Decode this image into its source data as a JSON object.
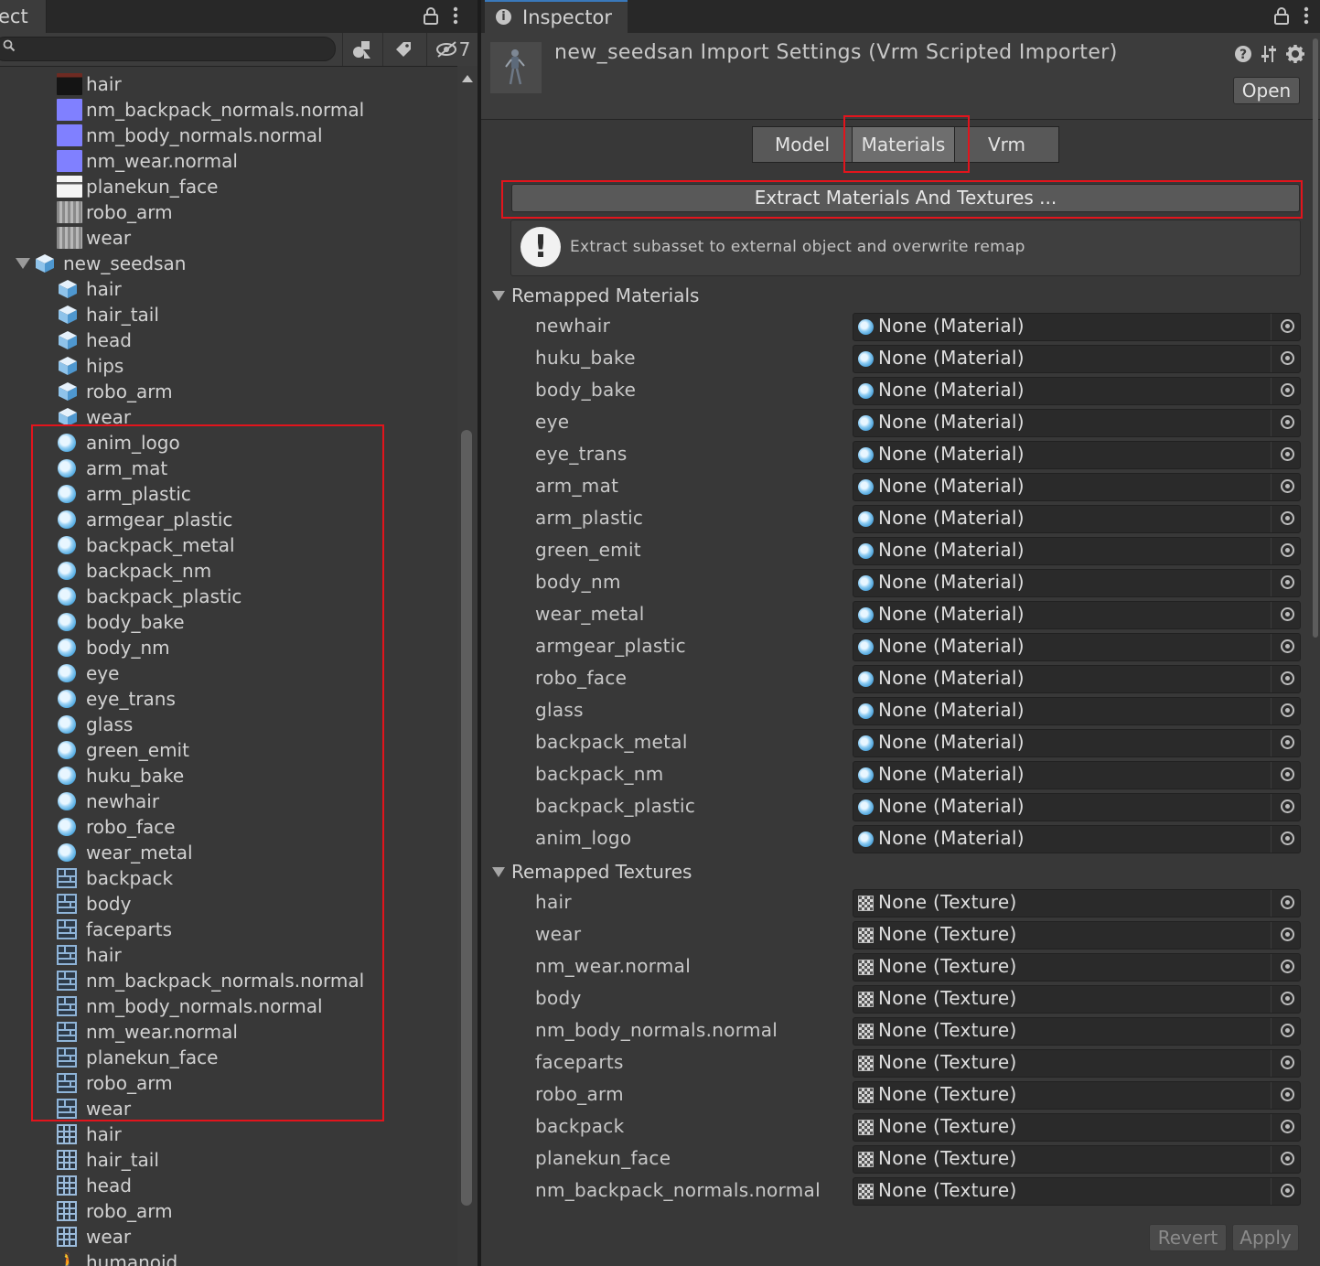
{
  "project": {
    "tab_title": "ect",
    "search": {
      "value": "",
      "placeholder": ""
    },
    "hidden_count": "7",
    "tree": [
      {
        "label": "hair",
        "icon": "texture-thumbnail-dark",
        "indent": 2
      },
      {
        "label": "nm_backpack_normals.normal",
        "icon": "normalmap-thumbnail",
        "indent": 2
      },
      {
        "label": "nm_body_normals.normal",
        "icon": "normalmap-thumbnail",
        "indent": 2
      },
      {
        "label": "nm_wear.normal",
        "icon": "normalmap-thumbnail",
        "indent": 2
      },
      {
        "label": "planekun_face",
        "icon": "face-texture-thumbnail",
        "indent": 2
      },
      {
        "label": "robo_arm",
        "icon": "texture-thumbnail-gray",
        "indent": 2
      },
      {
        "label": "wear",
        "icon": "texture-thumbnail-gray",
        "indent": 2
      },
      {
        "label": "new_seedsan",
        "icon": "prefab-icon",
        "indent": 1,
        "expanded": true
      },
      {
        "label": "hair",
        "icon": "prefab-icon",
        "indent": 2
      },
      {
        "label": "hair_tail",
        "icon": "prefab-icon",
        "indent": 2
      },
      {
        "label": "head",
        "icon": "prefab-icon",
        "indent": 2
      },
      {
        "label": "hips",
        "icon": "prefab-icon",
        "indent": 2
      },
      {
        "label": "robo_arm",
        "icon": "prefab-icon",
        "indent": 2
      },
      {
        "label": "wear",
        "icon": "prefab-icon",
        "indent": 2
      },
      {
        "label": "anim_logo",
        "icon": "material-icon",
        "indent": 2
      },
      {
        "label": "arm_mat",
        "icon": "material-icon",
        "indent": 2
      },
      {
        "label": "arm_plastic",
        "icon": "material-icon",
        "indent": 2
      },
      {
        "label": "armgear_plastic",
        "icon": "material-icon",
        "indent": 2
      },
      {
        "label": "backpack_metal",
        "icon": "material-icon",
        "indent": 2
      },
      {
        "label": "backpack_nm",
        "icon": "material-icon",
        "indent": 2
      },
      {
        "label": "backpack_plastic",
        "icon": "material-icon",
        "indent": 2
      },
      {
        "label": "body_bake",
        "icon": "material-icon",
        "indent": 2
      },
      {
        "label": "body_nm",
        "icon": "material-icon",
        "indent": 2
      },
      {
        "label": "eye",
        "icon": "material-icon",
        "indent": 2
      },
      {
        "label": "eye_trans",
        "icon": "material-icon",
        "indent": 2
      },
      {
        "label": "glass",
        "icon": "material-icon",
        "indent": 2
      },
      {
        "label": "green_emit",
        "icon": "material-icon",
        "indent": 2
      },
      {
        "label": "huku_bake",
        "icon": "material-icon",
        "indent": 2
      },
      {
        "label": "newhair",
        "icon": "material-icon",
        "indent": 2
      },
      {
        "label": "robo_face",
        "icon": "material-icon",
        "indent": 2
      },
      {
        "label": "wear_metal",
        "icon": "material-icon",
        "indent": 2
      },
      {
        "label": "backpack",
        "icon": "texture2d-icon",
        "indent": 2
      },
      {
        "label": "body",
        "icon": "texture2d-icon",
        "indent": 2
      },
      {
        "label": "faceparts",
        "icon": "texture2d-icon",
        "indent": 2
      },
      {
        "label": "hair",
        "icon": "texture2d-icon",
        "indent": 2
      },
      {
        "label": "nm_backpack_normals.normal",
        "icon": "texture2d-icon",
        "indent": 2
      },
      {
        "label": "nm_body_normals.normal",
        "icon": "texture2d-icon",
        "indent": 2
      },
      {
        "label": "nm_wear.normal",
        "icon": "texture2d-icon",
        "indent": 2
      },
      {
        "label": "planekun_face",
        "icon": "texture2d-icon",
        "indent": 2
      },
      {
        "label": "robo_arm",
        "icon": "texture2d-icon",
        "indent": 2
      },
      {
        "label": "wear",
        "icon": "texture2d-icon",
        "indent": 2
      },
      {
        "label": "hair",
        "icon": "mesh-icon",
        "indent": 2
      },
      {
        "label": "hair_tail",
        "icon": "mesh-icon",
        "indent": 2
      },
      {
        "label": "head",
        "icon": "mesh-icon",
        "indent": 2
      },
      {
        "label": "robo_arm",
        "icon": "mesh-icon",
        "indent": 2
      },
      {
        "label": "wear",
        "icon": "mesh-icon",
        "indent": 2
      },
      {
        "label": "humanoid",
        "icon": "humanoid-avatar-icon",
        "indent": 2
      }
    ]
  },
  "inspector": {
    "tab_title": "Inspector",
    "title": "new_seedsan Import Settings (Vrm Scripted Importer)",
    "open_label": "Open",
    "tabs": [
      {
        "label": "Model",
        "selected": false
      },
      {
        "label": "Materials",
        "selected": true
      },
      {
        "label": "Vrm",
        "selected": false
      }
    ],
    "extract_label": "Extract Materials And Textures ...",
    "help_message": "Extract subasset to external object and overwrite remap",
    "remapped_materials": {
      "title": "Remapped Materials",
      "items": [
        {
          "name": "newhair",
          "value": "None (Material)"
        },
        {
          "name": "huku_bake",
          "value": "None (Material)"
        },
        {
          "name": "body_bake",
          "value": "None (Material)"
        },
        {
          "name": "eye",
          "value": "None (Material)"
        },
        {
          "name": "eye_trans",
          "value": "None (Material)"
        },
        {
          "name": "arm_mat",
          "value": "None (Material)"
        },
        {
          "name": "arm_plastic",
          "value": "None (Material)"
        },
        {
          "name": "green_emit",
          "value": "None (Material)"
        },
        {
          "name": "body_nm",
          "value": "None (Material)"
        },
        {
          "name": "wear_metal",
          "value": "None (Material)"
        },
        {
          "name": "armgear_plastic",
          "value": "None (Material)"
        },
        {
          "name": "robo_face",
          "value": "None (Material)"
        },
        {
          "name": "glass",
          "value": "None (Material)"
        },
        {
          "name": "backpack_metal",
          "value": "None (Material)"
        },
        {
          "name": "backpack_nm",
          "value": "None (Material)"
        },
        {
          "name": "backpack_plastic",
          "value": "None (Material)"
        },
        {
          "name": "anim_logo",
          "value": "None (Material)"
        }
      ]
    },
    "remapped_textures": {
      "title": "Remapped Textures",
      "items": [
        {
          "name": "hair",
          "value": "None (Texture)"
        },
        {
          "name": "wear",
          "value": "None (Texture)"
        },
        {
          "name": "nm_wear.normal",
          "value": "None (Texture)"
        },
        {
          "name": "body",
          "value": "None (Texture)"
        },
        {
          "name": "nm_body_normals.normal",
          "value": "None (Texture)"
        },
        {
          "name": "faceparts",
          "value": "None (Texture)"
        },
        {
          "name": "robo_arm",
          "value": "None (Texture)"
        },
        {
          "name": "backpack",
          "value": "None (Texture)"
        },
        {
          "name": "planekun_face",
          "value": "None (Texture)"
        },
        {
          "name": "nm_backpack_normals.normal",
          "value": "None (Texture)"
        }
      ]
    },
    "revert_label": "Revert",
    "apply_label": "Apply"
  },
  "colors": {
    "highlight_box": "#e2141c",
    "panel_bg": "#383838",
    "field_bg": "#2a2a2a",
    "tab_accent": "#3a79bb"
  }
}
